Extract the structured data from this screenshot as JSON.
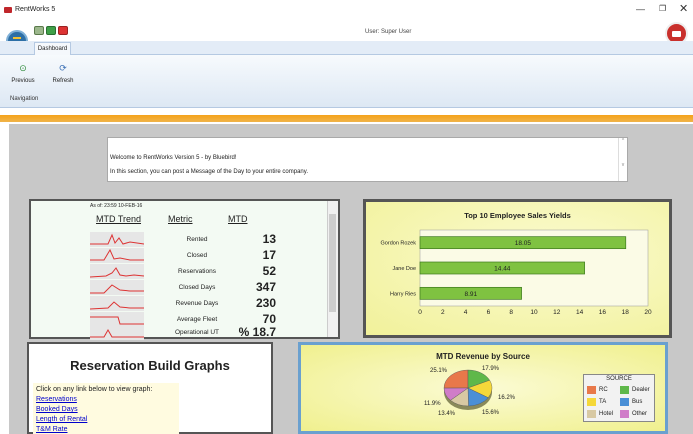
{
  "window": {
    "title": "RentWorks 5",
    "user": "User: Super User"
  },
  "ribbon": {
    "tab": "Dashboard",
    "buttons": [
      {
        "label": "Previous",
        "icon": "previous-icon"
      },
      {
        "label": "Refresh",
        "icon": "refresh-icon"
      }
    ],
    "group_label": "Navigation"
  },
  "message": {
    "line1": "Welcome to RentWorks Version 5 - by Bluebird!",
    "line2": "In this section, you can post a Message of the Day to your entire company."
  },
  "mtd": {
    "as_of": "As of: 23:59 10-FEB-16",
    "headers": {
      "trend": "MTD Trend",
      "metric": "Metric",
      "mtd": "MTD"
    },
    "rows": [
      {
        "metric": "Rented",
        "value": "13"
      },
      {
        "metric": "Closed",
        "value": "17"
      },
      {
        "metric": "Reservations",
        "value": "52"
      },
      {
        "metric": "Closed Days",
        "value": "347"
      },
      {
        "metric": "Revenue Days",
        "value": "230"
      },
      {
        "metric": "Average Fleet",
        "value": "70"
      },
      {
        "metric": "Operational UT",
        "value": "% 18.7"
      }
    ]
  },
  "chart_data": [
    {
      "type": "bar",
      "title": "Top 10 Employee Sales Yields",
      "categories": [
        "Gordon Rozek",
        "Jane Doe",
        "Harry Ries"
      ],
      "values": [
        18.05,
        14.44,
        8.91
      ],
      "data_labels": [
        "18.05",
        "14.44",
        "8.91"
      ],
      "xlim": [
        0,
        20
      ],
      "ticks": [
        "0",
        "2",
        "4",
        "6",
        "8",
        "10",
        "12",
        "14",
        "16",
        "18",
        "20"
      ],
      "bar_color": "#7fc241"
    },
    {
      "type": "pie",
      "title": "MTD Revenue by Source",
      "legend_title": "SOURCE",
      "legend_position": "right",
      "slices": [
        {
          "name": "RC",
          "value": 25.1,
          "label": "25.1%",
          "color": "#e8784a"
        },
        {
          "name": "Dealer",
          "value": 17.9,
          "label": "17.9%",
          "color": "#5fb84a"
        },
        {
          "name": "TA",
          "value": 16.2,
          "label": "16.2%",
          "color": "#f5d83a"
        },
        {
          "name": "Bus",
          "value": 15.6,
          "label": "15.6%",
          "color": "#4a8fd6"
        },
        {
          "name": "Hotel",
          "value": 13.4,
          "label": "13.4%",
          "color": "#d8c9a3"
        },
        {
          "name": "Other",
          "value": 11.9,
          "label": "11.9%",
          "color": "#d07cc8"
        }
      ]
    }
  ],
  "reservation": {
    "title": "Reservation Build Graphs",
    "intro": "Click on any link below to view graph:",
    "links": [
      "Reservations",
      "Booked Days",
      "Length of Rental",
      "T&M Rate"
    ]
  }
}
